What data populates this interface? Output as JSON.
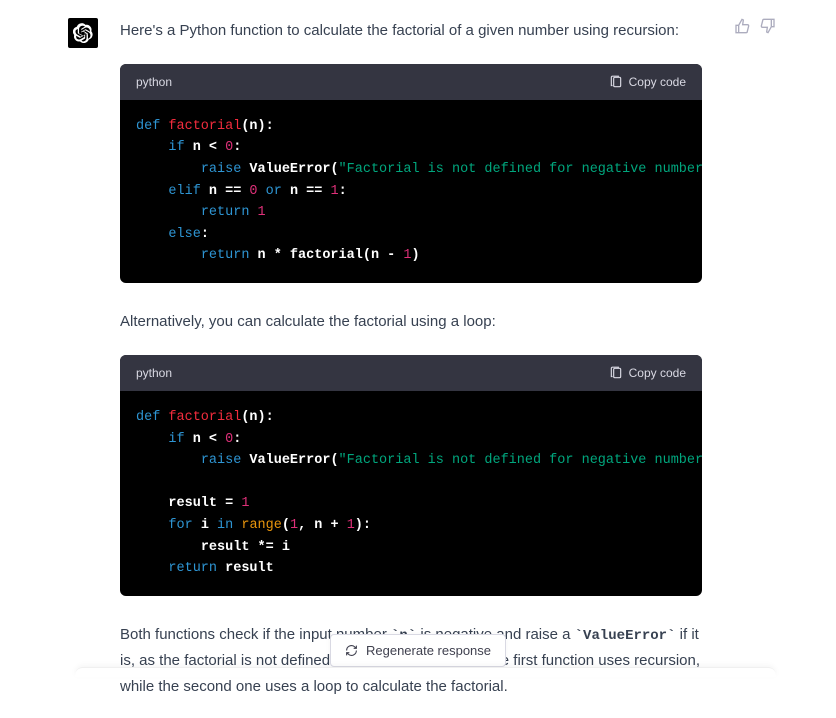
{
  "intro_text": "Here's a Python function to calculate the factorial of a given number using recursion:",
  "alt_text": "Alternatively, you can calculate the factorial using a loop:",
  "outro_pre": "Both functions check if the input number ",
  "outro_inline_n": "`n`",
  "outro_mid": " is negative and raise a ",
  "outro_inline_err": "`ValueError`",
  "outro_post": " if it is, as the factorial is not defined for negative numbers. The first function uses recursion, while the second one uses a loop to calculate the factorial.",
  "code1": {
    "lang": "python",
    "copy_label": "Copy code",
    "tokens": [
      [
        "kw",
        "def "
      ],
      [
        "fn",
        "factorial"
      ],
      [
        "pn",
        "(n):"
      ],
      [
        "nl",
        ""
      ],
      [
        "sp",
        "    "
      ],
      [
        "kw",
        "if"
      ],
      [
        "id",
        " n < "
      ],
      [
        "num",
        "0"
      ],
      [
        "pn",
        ":"
      ],
      [
        "nl",
        ""
      ],
      [
        "sp",
        "        "
      ],
      [
        "kw",
        "raise"
      ],
      [
        "id",
        " ValueError("
      ],
      [
        "str",
        "\"Factorial is not defined for negative numbers\""
      ],
      [
        "pn",
        ")"
      ],
      [
        "nl",
        ""
      ],
      [
        "sp",
        "    "
      ],
      [
        "kw",
        "elif"
      ],
      [
        "id",
        " n == "
      ],
      [
        "num",
        "0"
      ],
      [
        "kw",
        " or"
      ],
      [
        "id",
        " n == "
      ],
      [
        "num",
        "1"
      ],
      [
        "pn",
        ":"
      ],
      [
        "nl",
        ""
      ],
      [
        "sp",
        "        "
      ],
      [
        "kw",
        "return "
      ],
      [
        "num",
        "1"
      ],
      [
        "nl",
        ""
      ],
      [
        "sp",
        "    "
      ],
      [
        "kw",
        "else"
      ],
      [
        "pn",
        ":"
      ],
      [
        "nl",
        ""
      ],
      [
        "sp",
        "        "
      ],
      [
        "kw",
        "return"
      ],
      [
        "id",
        " n * factorial(n - "
      ],
      [
        "num",
        "1"
      ],
      [
        "pn",
        ")"
      ]
    ]
  },
  "code2": {
    "lang": "python",
    "copy_label": "Copy code",
    "tokens": [
      [
        "kw",
        "def "
      ],
      [
        "fn",
        "factorial"
      ],
      [
        "pn",
        "(n):"
      ],
      [
        "nl",
        ""
      ],
      [
        "sp",
        "    "
      ],
      [
        "kw",
        "if"
      ],
      [
        "id",
        " n < "
      ],
      [
        "num",
        "0"
      ],
      [
        "pn",
        ":"
      ],
      [
        "nl",
        ""
      ],
      [
        "sp",
        "        "
      ],
      [
        "kw",
        "raise"
      ],
      [
        "id",
        " ValueError("
      ],
      [
        "str",
        "\"Factorial is not defined for negative numbers\""
      ],
      [
        "pn",
        ")"
      ],
      [
        "nl",
        ""
      ],
      [
        "nl",
        ""
      ],
      [
        "sp",
        "    "
      ],
      [
        "id",
        "result = "
      ],
      [
        "num",
        "1"
      ],
      [
        "nl",
        ""
      ],
      [
        "sp",
        "    "
      ],
      [
        "kw",
        "for"
      ],
      [
        "id",
        " i "
      ],
      [
        "kw",
        "in"
      ],
      [
        "id",
        " "
      ],
      [
        "bi",
        "range"
      ],
      [
        "id",
        "("
      ],
      [
        "num",
        "1"
      ],
      [
        "id",
        ", n + "
      ],
      [
        "num",
        "1"
      ],
      [
        "pn",
        "):"
      ],
      [
        "nl",
        ""
      ],
      [
        "sp",
        "        "
      ],
      [
        "id",
        "result *= i"
      ],
      [
        "nl",
        ""
      ],
      [
        "sp",
        "    "
      ],
      [
        "kw",
        "return"
      ],
      [
        "id",
        " result"
      ]
    ]
  },
  "regen_label": "Regenerate response"
}
